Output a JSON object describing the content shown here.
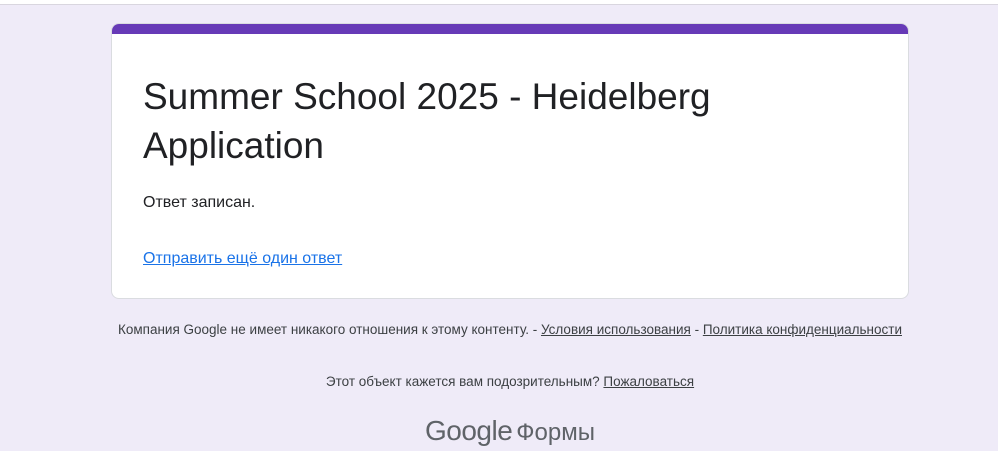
{
  "form": {
    "title": "Summer School 2025 - Heidelberg Application",
    "confirmation": "Ответ записан.",
    "resubmit_link": "Отправить ещё один ответ",
    "accent_color": "#673ab7"
  },
  "footer": {
    "disclaimer_text": "Компания Google не имеет никакого отношения к этому контенту. - ",
    "terms_link": "Условия использования",
    "separator": " - ",
    "privacy_link": "Политика конфиденциальности",
    "report_text": "Этот объект кажется вам подозрительным? ",
    "report_link": "Пожаловаться",
    "brand_google": "Google",
    "brand_product": "Формы"
  }
}
